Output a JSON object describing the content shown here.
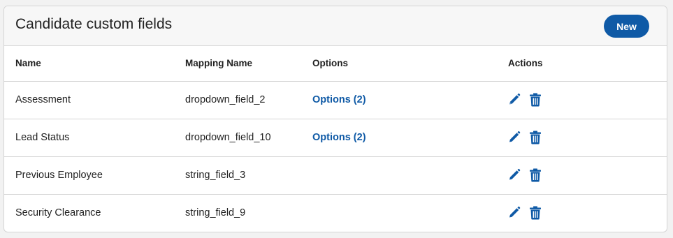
{
  "card": {
    "title": "Candidate custom fields",
    "new_label": "New"
  },
  "table": {
    "headers": [
      "Name",
      "Mapping Name",
      "Options",
      "Actions"
    ],
    "rows": [
      {
        "name": "Assessment",
        "mapping": "dropdown_field_2",
        "options": "Options (2)"
      },
      {
        "name": "Lead Status",
        "mapping": "dropdown_field_10",
        "options": "Options (2)"
      },
      {
        "name": "Previous Employee",
        "mapping": "string_field_3",
        "options": ""
      },
      {
        "name": "Security Clearance",
        "mapping": "string_field_9",
        "options": ""
      }
    ]
  },
  "icons": {
    "edit": "pencil-icon",
    "delete": "trash-icon"
  },
  "colors": {
    "accent": "#0f5aa6",
    "header_bg": "#f7f7f7",
    "border": "#d4d4d4"
  }
}
